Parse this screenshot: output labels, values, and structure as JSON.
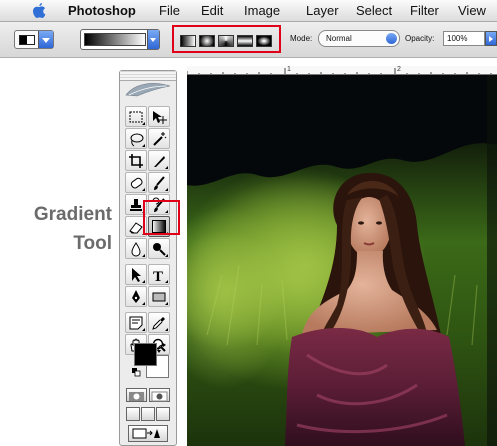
{
  "menubar": {
    "items": [
      "Photoshop",
      "File",
      "Edit",
      "Image",
      "Layer",
      "Select",
      "Filter",
      "View"
    ]
  },
  "options_bar": {
    "mode_label": "Mode:",
    "mode_value": "Normal",
    "opacity_label": "Opacity:",
    "opacity_value": "100%",
    "gradient_types": [
      "linear-gradient-icon",
      "radial-gradient-icon",
      "angle-gradient-icon",
      "reflected-gradient-icon",
      "diamond-gradient-icon"
    ]
  },
  "callout": {
    "line1": "Gradient",
    "line2": "Tool",
    "highlight_color": "#e1001a"
  },
  "ruler": {
    "marks": [
      "1",
      "2"
    ]
  },
  "toolbox": {
    "foreground_color": "#000000",
    "background_color": "#ffffff"
  },
  "colors": {
    "accent_blue": "#2e66d6",
    "highlight_red": "#e1001a",
    "callout_gray": "#6b6b6b"
  }
}
